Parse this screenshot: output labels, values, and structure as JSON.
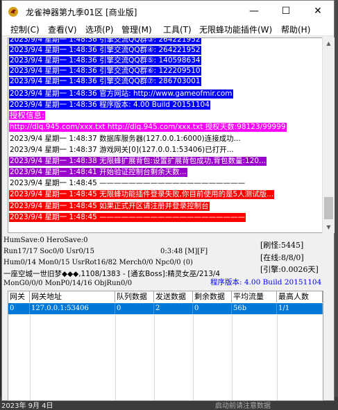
{
  "window": {
    "title": "龙雀神器第九季01区 [商业版]",
    "minimize_glyph": "—",
    "maximize_glyph": "☐",
    "close_glyph": "✕"
  },
  "menu": [
    "控制(C)",
    "查看(V)",
    "选项(P)",
    "管理(M)",
    "工具(T)",
    "无限蜂功能插件(W)",
    "帮助(H)"
  ],
  "log": [
    {
      "text": "2023/9/4 星期一 1:48:36 引擎交流QQ群③: 264221952",
      "bg": "#0000ff",
      "fg": "#ffffff"
    },
    {
      "text": "2023/9/4 星期一 1:48:36 引擎交流QQ群④: 264221952",
      "bg": "#0000ff",
      "fg": "#ffffff"
    },
    {
      "text": "2023/9/4 星期一 1:48:36 引擎交流QQ群⑤: 140598634",
      "bg": "#0000ff",
      "fg": "#ffffff"
    },
    {
      "text": "2023/9/4 星期一 1:48:36 引擎交流QQ群⑥: 122209510",
      "bg": "#0000ff",
      "fg": "#ffffff"
    },
    {
      "text": "2023/9/4 星期一 1:48:36 引擎交流QQ群⑦: 286703001",
      "bg": "#0000ff",
      "fg": "#ffffff"
    },
    {
      "text": "2023/9/4 星期一 1:48:36 官方网站: http://www.gameofmir.com",
      "bg": "#0000ff",
      "fg": "#ffffff"
    },
    {
      "text": "2023/9/4 星期一 1:48:36 程序版本: 4.00 Build 20151104",
      "bg": "#0000ff",
      "fg": "#ffffff"
    },
    {
      "text": "授权信息:",
      "bg": "#ff00ff",
      "fg": "#ffffff"
    },
    {
      "text": "http://dlq.945.com/xxx.txt http://dlq.945.com/xxx.txt 授权天数:98123/99999",
      "bg": "#ff00ff",
      "fg": "#ffffff"
    },
    {
      "text": "2023/9/4 星期一 1:48:37 数据库服务器(127.0.0.1:6000)连接成功...",
      "bg": "#ffffff",
      "fg": "#000000"
    },
    {
      "text": "2023/9/4 星期一 1:48:37 游戏网关[0](127.0.0.1:53406)已打开...",
      "bg": "#ffffff",
      "fg": "#000000"
    },
    {
      "text": "2023/9/4 星期一 1:48:38 无限蜂扩展背包:设置扩展背包成功,背包数量:120...",
      "bg": "#9900cc",
      "fg": "#ffffff"
    },
    {
      "text": "2023/9/4 星期一 1:48:41 开始验证控制台剩余天数...",
      "bg": "#9900cc",
      "fg": "#ffffff"
    },
    {
      "text": "2023/9/4 星期一 1:48:45 ————————————————————",
      "bg": "#ffffff",
      "fg": "#000000"
    },
    {
      "text": "2023/9/4 星期一 1:48:45 无限蜂功能插件登录失败,你目前使用的是5人测试版...",
      "bg": "#ff0000",
      "fg": "#ffffff"
    },
    {
      "text": "2023/9/4 星期一 1:48:45 如果正式开区请注册并登录控制台",
      "bg": "#ff0000",
      "fg": "#ffffff"
    },
    {
      "text": "2023/9/4 星期一 1:48:45 ————————————————————",
      "bg": "#ff0000",
      "fg": "#ffffff"
    }
  ],
  "status": {
    "line1": "HumSave:0 HeroSave:0",
    "brush": "[刷怪:5445]",
    "line2": "Run17/17 Soc0/0 Usr0/15",
    "time": "0:3:48 [M][F]",
    "online": "[在线:8/8/0]",
    "line3": "Hum0/14 Mon0/15 UsrRot16/82 Merch0/0 Npc0/0 (0)",
    "engine": "[引擎:0.0026天]",
    "line4": "一座空城一世旧梦◆◆◆,1108/1383 - [通玄Boss]:精灵女巫/213/4",
    "line5": "MonG0/0/0 MonP0/14/16 ObjRun0/0",
    "version": "程序版本: 4.00 Build 20151104"
  },
  "grid": {
    "headers": [
      "网关",
      "网关地址",
      "队列数据",
      "发送数据",
      "剩余数据",
      "平均流量",
      "最高人数"
    ],
    "rows": [
      [
        "0",
        "127.0.0.1:53406",
        "0",
        "2",
        "0",
        "56b",
        "1/1"
      ]
    ]
  },
  "background": {
    "bottom_date": "2023年 9月 4日",
    "bottom_right": "启动前请注意数据"
  }
}
